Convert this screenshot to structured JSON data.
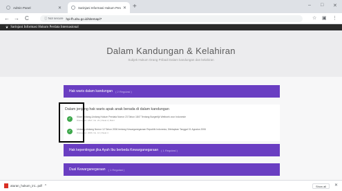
{
  "browser": {
    "tabs": [
      {
        "title": "Admin Panel",
        "active": false
      },
      {
        "title": "Sarinjani Informasi Hukum Perda",
        "active": true
      }
    ],
    "new_tab": "+",
    "window_controls": [
      "–",
      "□",
      "✕"
    ],
    "back": "←",
    "forward": "→",
    "reload": "C",
    "security": "ⓘ Not secure",
    "url": "hpi-fh.ahu.go.id/sitemap/7",
    "star": "☆",
    "menu": "⋮"
  },
  "site": {
    "logo": "❦",
    "name": "Sarinjani Informasi Hukum Perdata Internasional"
  },
  "hero": {
    "title": "Dalam Kandungan & Kelahiran",
    "subtitle": "Subjek Hukum Orang Pribadi Dalam kandungan dan kelahiran"
  },
  "accordions": [
    {
      "label": "Hak waris dalam kandungan",
      "sub": "( 2 Regulasi )"
    },
    {
      "label": "Hak kepentingan jika Ayah Ibu berbeda Kewarganegaraan",
      "sub": "( 1 Regulasi )"
    },
    {
      "label": "Dual Kewarganegaraan",
      "sub": "( 1 Regulasi )"
    }
  ],
  "panel": {
    "lead": "Dalam jenjang hak waris apak anak berada di dalam kandungan",
    "items": [
      {
        "line1": "Kitab Undang-Undang Hukum Perdata Nomor 23 Tahun 1847 Tentang Burgerlijk Wetboek voor Indonesie",
        "line2": "Ditetapkan: 1847, No. 23 | Pasal 2 | Bab I"
      },
      {
        "line1": "Undang-Undang Nomor 12 Tahun 2006 tentang Kewarganegaraan Republik Indonesia, Ditetapkan Tanggal 01 Agustus 2006",
        "line2": "Ditetapkan: 2006, No. 12 | Pasal 4"
      }
    ]
  },
  "downloads": {
    "file": "aturan_hukum_ini...pdf",
    "caret": "^",
    "show_all": "Show all",
    "close": "✕"
  }
}
